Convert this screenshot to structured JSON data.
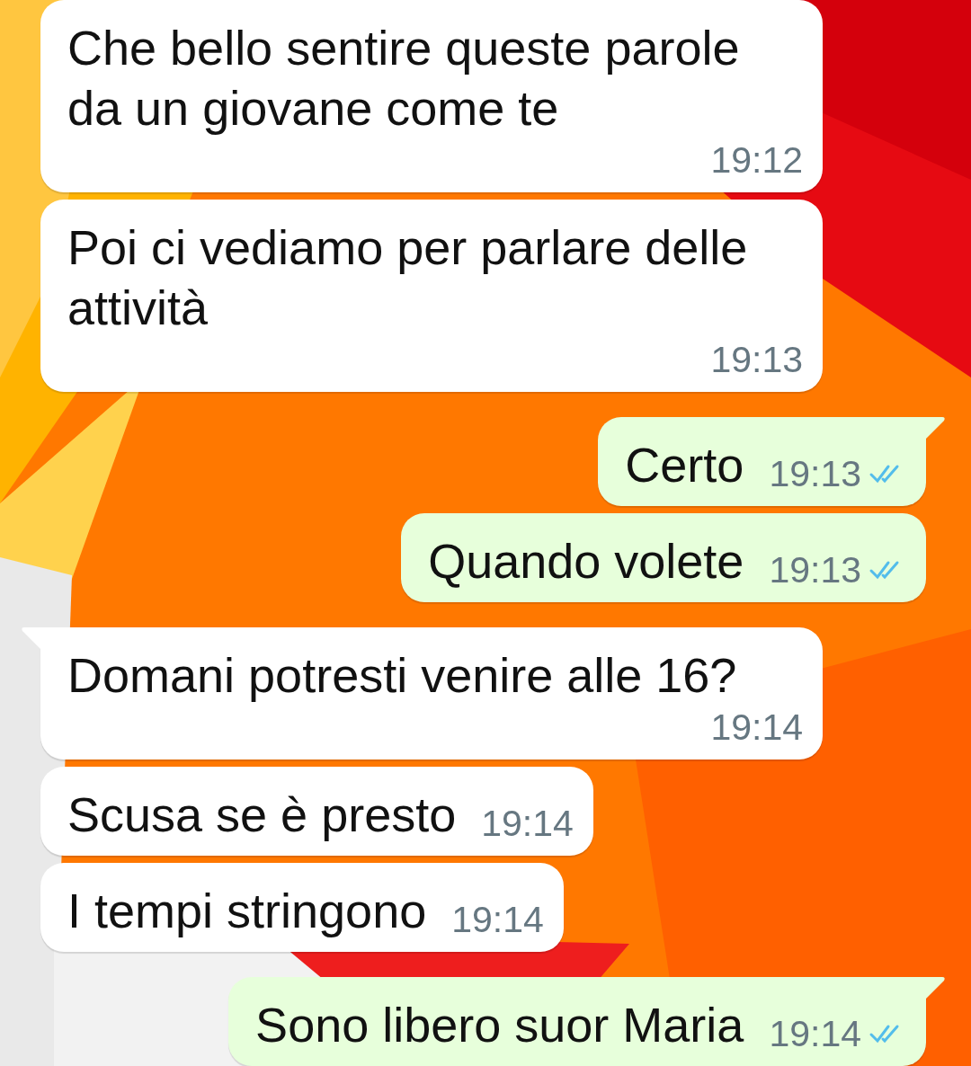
{
  "messages": [
    {
      "kind": "incoming",
      "tail": false,
      "text": "Che bello sentire queste parole da un giovane come te",
      "time": "19:12"
    },
    {
      "kind": "incoming",
      "tail": false,
      "text": "Poi ci vediamo per parlare delle attività",
      "time": "19:13"
    },
    {
      "kind": "outgoing",
      "tail": true,
      "text": "Certo",
      "time": "19:13",
      "read": true
    },
    {
      "kind": "outgoing",
      "tail": false,
      "text": "Quando volete",
      "time": "19:13",
      "read": true
    },
    {
      "kind": "incoming",
      "tail": true,
      "text": "Domani potresti venire alle 16?",
      "time": "19:14"
    },
    {
      "kind": "incoming",
      "tail": false,
      "text": "Scusa se è presto",
      "time": "19:14"
    },
    {
      "kind": "incoming",
      "tail": false,
      "text": "I tempi stringono",
      "time": "19:14"
    },
    {
      "kind": "outgoing",
      "tail": true,
      "text": "Sono libero suor Maria",
      "time": "19:14",
      "read": true
    }
  ]
}
